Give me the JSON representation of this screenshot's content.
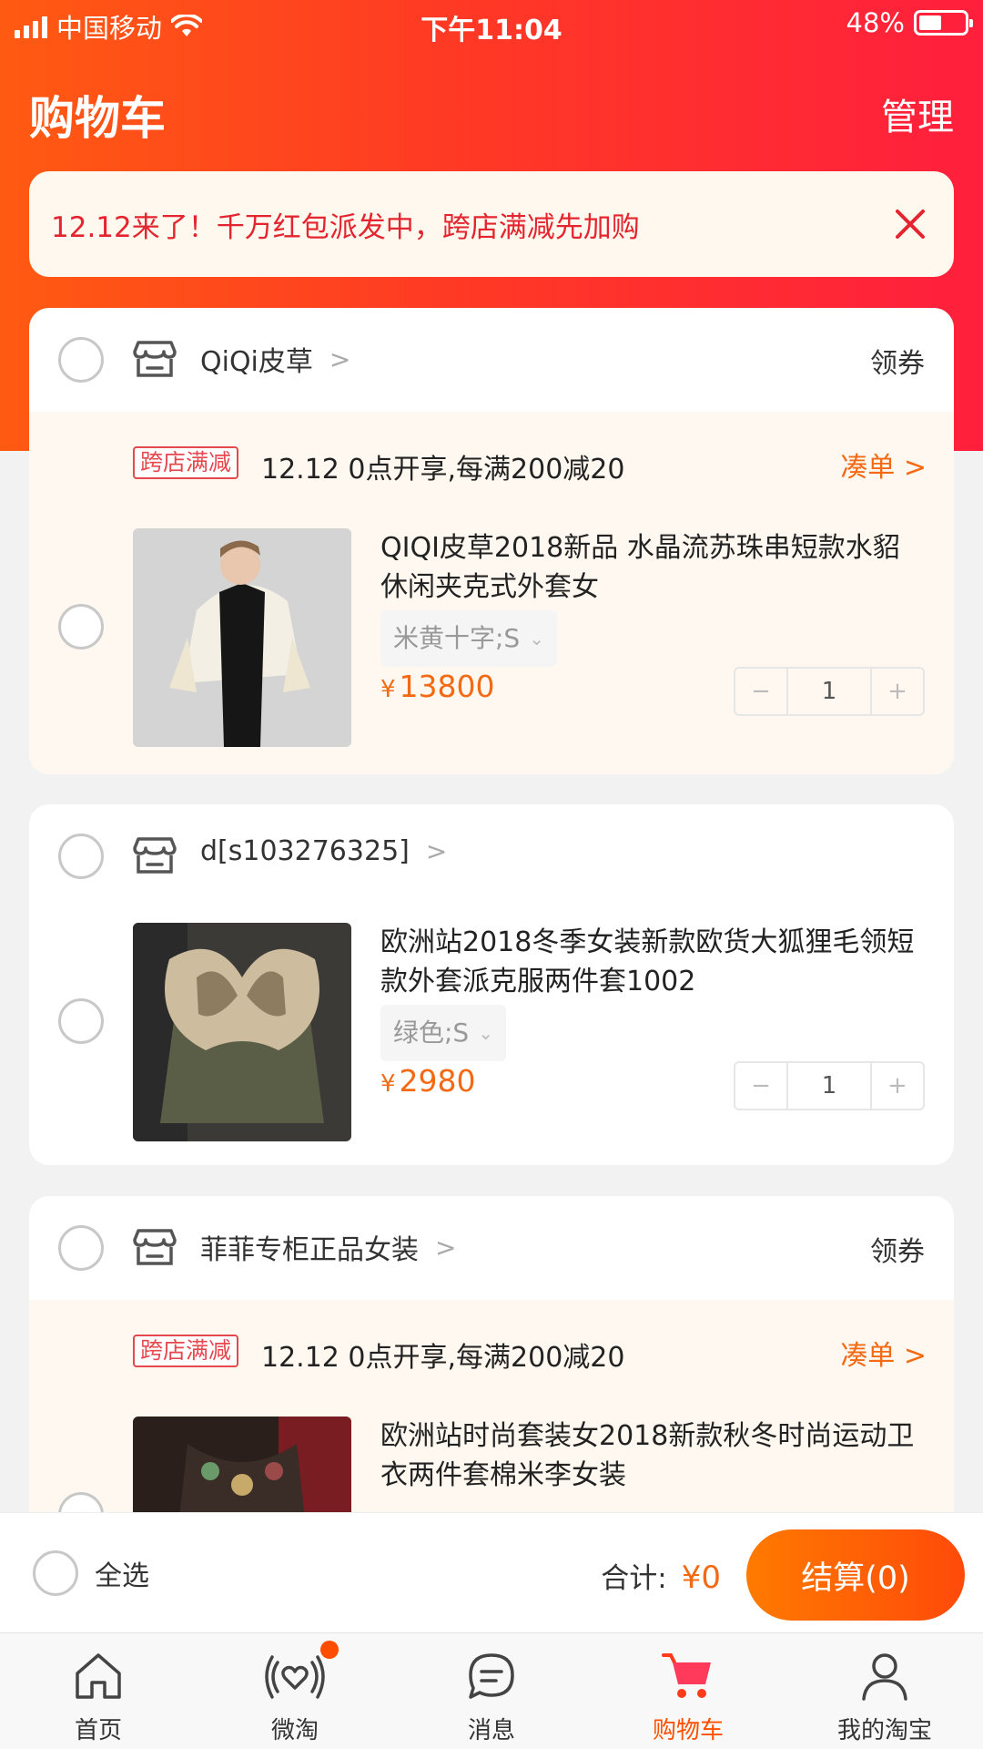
{
  "status_bar": {
    "carrier": "中国移动",
    "time": "下午11:04",
    "battery": "48%",
    "battery_level": 0.48
  },
  "header": {
    "title": "购物车",
    "manage": "管理"
  },
  "promo_banner": {
    "text": "12.12来了！千万红包派发中，跨店满减先加购",
    "close_icon": "close-icon"
  },
  "shops": [
    {
      "name": "QiQi皮草",
      "coupon": "领券",
      "deal": {
        "tag": "跨店满减",
        "text": "12.12 0点开享,每满200减20",
        "link": "凑单"
      },
      "items": [
        {
          "title": "QIQI皮草2018新品 水晶流苏珠串短款水貂休闲夹克式外套女",
          "sku": "米黄十字;S",
          "currency": "¥",
          "price": "13800",
          "qty": "1"
        }
      ]
    },
    {
      "name": "d[s103276325]",
      "items": [
        {
          "title": "欧洲站2018冬季女装新款欧货大狐狸毛领短款外套派克服两件套1002",
          "sku": "绿色;S",
          "currency": "¥",
          "price": "2980",
          "qty": "1"
        }
      ]
    },
    {
      "name": "菲菲专柜正品女装",
      "coupon": "领券",
      "deal": {
        "tag": "跨店满减",
        "text": "12.12 0点开享,每满200减20",
        "link": "凑单"
      },
      "items": [
        {
          "title": "欧洲站时尚套装女2018新款秋冬时尚运动卫衣两件套棉米李女装"
        }
      ]
    }
  ],
  "checkout": {
    "select_all": "全选",
    "total_label": "合计:",
    "total_amount": "¥0",
    "pay_button": "结算(0)"
  },
  "tabbar": [
    {
      "label": "首页",
      "icon": "home-icon"
    },
    {
      "label": "微淘",
      "icon": "heart-broadcast-icon"
    },
    {
      "label": "消息",
      "icon": "message-icon"
    },
    {
      "label": "购物车",
      "icon": "cart-icon",
      "active": true
    },
    {
      "label": "我的淘宝",
      "icon": "user-icon"
    }
  ],
  "colors": {
    "accent": "#ff5000",
    "price": "#f46a14",
    "promo_text": "#e4242e",
    "header_start": "#ff5a12",
    "header_end": "#ff1f3d"
  }
}
